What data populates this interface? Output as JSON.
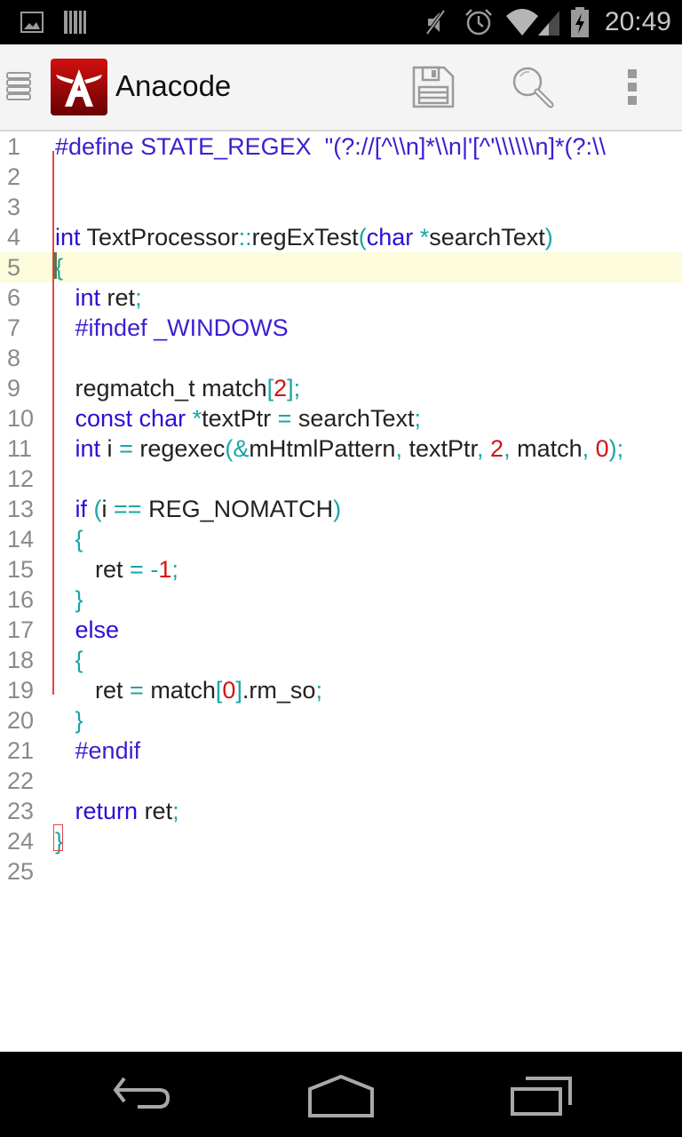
{
  "status_bar": {
    "time": "20:49",
    "left_icons": [
      "image-notification-icon",
      "barcode-notification-icon"
    ],
    "right_icons": [
      "mute-icon",
      "alarm-icon",
      "wifi-icon",
      "signal-icon",
      "battery-charging-icon"
    ]
  },
  "action_bar": {
    "app_title": "Anacode",
    "actions": [
      {
        "name": "save",
        "icon": "floppy-disk-icon"
      },
      {
        "name": "search",
        "icon": "magnifier-icon"
      },
      {
        "name": "overflow",
        "icon": "more-vertical-icon"
      }
    ],
    "brand_color": "#b00000"
  },
  "editor": {
    "current_line": 5,
    "lines": [
      {
        "n": "1",
        "tokens": [
          {
            "t": "#define STATE_REGEX  \"(?://[^\\\\n]*\\\\n|'[^'\\\\\\\\\\\\n]*(?:\\\\",
            "c": "pp"
          }
        ]
      },
      {
        "n": "2",
        "tokens": []
      },
      {
        "n": "3",
        "tokens": []
      },
      {
        "n": "4",
        "tokens": [
          {
            "t": "int",
            "c": "kw"
          },
          {
            "t": " TextProcessor",
            "c": ""
          },
          {
            "t": "::",
            "c": "op"
          },
          {
            "t": "regExTest",
            "c": ""
          },
          {
            "t": "(",
            "c": "op"
          },
          {
            "t": "char",
            "c": "kw"
          },
          {
            "t": " *",
            "c": "op"
          },
          {
            "t": "searchText",
            "c": ""
          },
          {
            "t": ")",
            "c": "op"
          }
        ]
      },
      {
        "n": "5",
        "tokens": [
          {
            "t": "{",
            "c": "op"
          }
        ]
      },
      {
        "n": "6",
        "tokens": [
          {
            "t": "   ",
            "c": ""
          },
          {
            "t": "int",
            "c": "kw"
          },
          {
            "t": " ret",
            "c": ""
          },
          {
            "t": ";",
            "c": "op"
          }
        ]
      },
      {
        "n": "7",
        "tokens": [
          {
            "t": "   ",
            "c": ""
          },
          {
            "t": "#ifndef _WINDOWS",
            "c": "pp"
          }
        ]
      },
      {
        "n": "8",
        "tokens": []
      },
      {
        "n": "9",
        "tokens": [
          {
            "t": "   regmatch_t match",
            "c": ""
          },
          {
            "t": "[",
            "c": "op"
          },
          {
            "t": "2",
            "c": "num"
          },
          {
            "t": "];",
            "c": "op"
          }
        ]
      },
      {
        "n": "10",
        "tokens": [
          {
            "t": "   ",
            "c": ""
          },
          {
            "t": "const char",
            "c": "kw"
          },
          {
            "t": " *",
            "c": "op"
          },
          {
            "t": "textPtr ",
            "c": ""
          },
          {
            "t": "=",
            "c": "op"
          },
          {
            "t": " searchText",
            "c": ""
          },
          {
            "t": ";",
            "c": "op"
          }
        ]
      },
      {
        "n": "11",
        "tokens": [
          {
            "t": "   ",
            "c": ""
          },
          {
            "t": "int",
            "c": "kw"
          },
          {
            "t": " i ",
            "c": ""
          },
          {
            "t": "=",
            "c": "op"
          },
          {
            "t": " regexec",
            "c": ""
          },
          {
            "t": "(&",
            "c": "op"
          },
          {
            "t": "mHtmlPattern",
            "c": ""
          },
          {
            "t": ",",
            "c": "op"
          },
          {
            "t": " textPtr",
            "c": ""
          },
          {
            "t": ", ",
            "c": "op"
          },
          {
            "t": "2",
            "c": "num"
          },
          {
            "t": ",",
            "c": "op"
          },
          {
            "t": " match",
            "c": ""
          },
          {
            "t": ", ",
            "c": "op"
          },
          {
            "t": "0",
            "c": "num"
          },
          {
            "t": ");",
            "c": "op"
          }
        ]
      },
      {
        "n": "12",
        "tokens": []
      },
      {
        "n": "13",
        "tokens": [
          {
            "t": "   ",
            "c": ""
          },
          {
            "t": "if",
            "c": "kw"
          },
          {
            "t": " (",
            "c": "op"
          },
          {
            "t": "i ",
            "c": ""
          },
          {
            "t": "==",
            "c": "op"
          },
          {
            "t": " REG_NOMATCH",
            "c": ""
          },
          {
            "t": ")",
            "c": "op"
          }
        ]
      },
      {
        "n": "14",
        "tokens": [
          {
            "t": "   ",
            "c": ""
          },
          {
            "t": "{",
            "c": "op"
          }
        ]
      },
      {
        "n": "15",
        "tokens": [
          {
            "t": "      ret ",
            "c": ""
          },
          {
            "t": "=",
            "c": "op"
          },
          {
            "t": " -",
            "c": "op"
          },
          {
            "t": "1",
            "c": "num"
          },
          {
            "t": ";",
            "c": "op"
          }
        ]
      },
      {
        "n": "16",
        "tokens": [
          {
            "t": "   ",
            "c": ""
          },
          {
            "t": "}",
            "c": "op"
          }
        ]
      },
      {
        "n": "17",
        "tokens": [
          {
            "t": "   ",
            "c": ""
          },
          {
            "t": "else",
            "c": "kw"
          }
        ]
      },
      {
        "n": "18",
        "tokens": [
          {
            "t": "   ",
            "c": ""
          },
          {
            "t": "{",
            "c": "op"
          }
        ]
      },
      {
        "n": "19",
        "tokens": [
          {
            "t": "      ret ",
            "c": ""
          },
          {
            "t": "=",
            "c": "op"
          },
          {
            "t": " match",
            "c": ""
          },
          {
            "t": "[",
            "c": "op"
          },
          {
            "t": "0",
            "c": "num"
          },
          {
            "t": "]",
            "c": "op"
          },
          {
            "t": ".rm_so",
            "c": ""
          },
          {
            "t": ";",
            "c": "op"
          }
        ]
      },
      {
        "n": "20",
        "tokens": [
          {
            "t": "   ",
            "c": ""
          },
          {
            "t": "}",
            "c": "op"
          }
        ]
      },
      {
        "n": "21",
        "tokens": [
          {
            "t": "   ",
            "c": ""
          },
          {
            "t": "#endif",
            "c": "pp"
          }
        ]
      },
      {
        "n": "22",
        "tokens": []
      },
      {
        "n": "23",
        "tokens": [
          {
            "t": "   ",
            "c": ""
          },
          {
            "t": "return",
            "c": "kw"
          },
          {
            "t": " ret",
            "c": ""
          },
          {
            "t": ";",
            "c": "op"
          }
        ]
      },
      {
        "n": "24",
        "tokens": [
          {
            "t": "}",
            "c": "op"
          }
        ]
      },
      {
        "n": "25",
        "tokens": []
      }
    ]
  },
  "nav_bar": {
    "buttons": [
      {
        "name": "back",
        "icon": "back-icon"
      },
      {
        "name": "home",
        "icon": "home-icon"
      },
      {
        "name": "recents",
        "icon": "recent-apps-icon"
      }
    ]
  }
}
